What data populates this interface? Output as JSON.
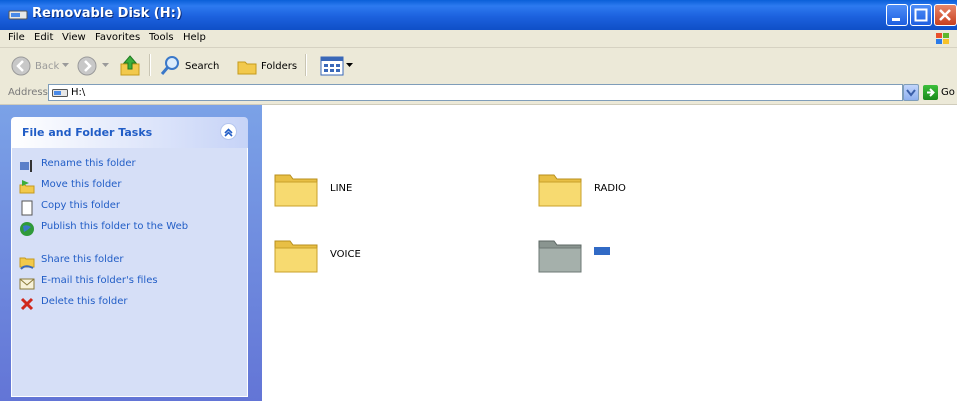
{
  "window": {
    "title": "Removable Disk (H:)"
  },
  "menu": [
    {
      "label": "File"
    },
    {
      "label": "Edit"
    },
    {
      "label": "View"
    },
    {
      "label": "Favorites"
    },
    {
      "label": "Tools"
    },
    {
      "label": "Help"
    }
  ],
  "toolbar": {
    "back_label": "Back",
    "search_label": "Search",
    "folders_label": "Folders"
  },
  "address": {
    "label": "Address",
    "value": "H:\\",
    "go_label": "Go"
  },
  "tasks": {
    "title": "File and Folder Tasks",
    "items": [
      {
        "label": "Rename this folder",
        "icon": "rename-icon"
      },
      {
        "label": "Move this folder",
        "icon": "move-icon"
      },
      {
        "label": "Copy this folder",
        "icon": "copy-icon"
      },
      {
        "label": "Publish this folder to the Web",
        "icon": "publish-web-icon"
      },
      {
        "label": "Share this folder",
        "icon": "share-icon"
      },
      {
        "label": "E-mail this folder's files",
        "icon": "email-icon"
      },
      {
        "label": "Delete this folder",
        "icon": "delete-icon"
      }
    ]
  },
  "items": [
    {
      "name": "LINE",
      "icon": "folder-icon"
    },
    {
      "name": "RADIO",
      "icon": "folder-icon"
    },
    {
      "name": "VOICE",
      "icon": "folder-icon"
    },
    {
      "name": "",
      "icon": "gray-folder-icon"
    }
  ],
  "colors": {
    "titlebar": "#0a5fd8",
    "task_link": "#215dc6",
    "task_panel_bg": "#d6dff7",
    "left_pane_bg": "#6f8ee0",
    "chrome": "#ece9d8",
    "folder": "#f5d66a"
  }
}
